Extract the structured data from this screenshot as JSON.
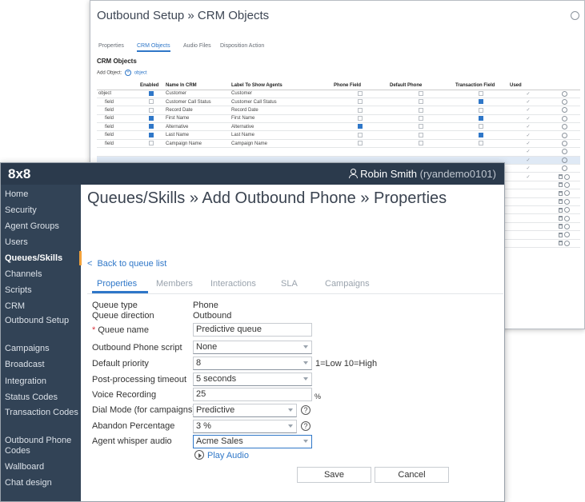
{
  "back_window": {
    "title": "Outbound Setup » CRM Objects",
    "tabs": [
      {
        "label": "Properties",
        "active": false
      },
      {
        "label": "CRM Objects",
        "active": true
      },
      {
        "label": "Audio Files",
        "active": false
      },
      {
        "label": "Disposition Action",
        "active": false
      }
    ],
    "section_title": "CRM Objects",
    "add_object_label": "Add Object:",
    "add_object_link": "object",
    "columns": [
      "",
      "Enabled",
      "Name In CRM",
      "Label To Show Agents",
      "Phone Field",
      "Default Phone",
      "Transaction Field",
      "Used",
      ""
    ],
    "rows": [
      {
        "type": "object",
        "enabled": true,
        "name": "Customer",
        "label": "Customer",
        "phone": false,
        "default_phone": false,
        "transaction": false,
        "used": "✓",
        "actions": "gear"
      },
      {
        "type": "field",
        "enabled": false,
        "name": "Customer Call Status",
        "label": "Customer Call Status",
        "phone": false,
        "default_phone": false,
        "transaction": true,
        "used": "✓",
        "actions": "gear"
      },
      {
        "type": "field",
        "enabled": false,
        "name": "Record Date",
        "label": "Record Date",
        "phone": false,
        "default_phone": false,
        "transaction": false,
        "used": "✓",
        "actions": "gear"
      },
      {
        "type": "field",
        "enabled": true,
        "name": "First Name",
        "label": "First Name",
        "phone": false,
        "default_phone": false,
        "transaction": true,
        "used": "✓",
        "actions": "gear"
      },
      {
        "type": "field",
        "enabled": true,
        "name": "Alternative",
        "label": "Alternative",
        "phone": true,
        "default_phone": false,
        "transaction": false,
        "used": "✓",
        "actions": "gear"
      },
      {
        "type": "field",
        "enabled": true,
        "name": "Last Name",
        "label": "Last Name",
        "phone": false,
        "default_phone": false,
        "transaction": true,
        "used": "✓",
        "actions": "gear"
      },
      {
        "type": "field",
        "enabled": false,
        "name": "Campaign Name",
        "label": "Campaign Name",
        "phone": false,
        "default_phone": false,
        "transaction": false,
        "used": "✓",
        "actions": "gear"
      }
    ]
  },
  "app": {
    "logo": "8x8",
    "user_name": "Robin Smith",
    "user_id": "(ryandemo0101)"
  },
  "sidebar": {
    "items": [
      {
        "label": "Home",
        "active": false
      },
      {
        "label": "Security",
        "active": false
      },
      {
        "label": "Agent Groups",
        "active": false
      },
      {
        "label": "Users",
        "active": false
      },
      {
        "label": "Queues/Skills",
        "active": true
      },
      {
        "label": "Channels",
        "active": false
      },
      {
        "label": "Scripts",
        "active": false
      },
      {
        "label": "CRM",
        "active": false
      },
      {
        "label": "Outbound Setup",
        "active": false
      },
      {
        "label": "Campaigns",
        "active": false
      },
      {
        "label": "Broadcast",
        "active": false
      },
      {
        "label": "Integration",
        "active": false
      },
      {
        "label": "Status Codes",
        "active": false
      },
      {
        "label": "Transaction Codes",
        "active": false
      },
      {
        "label": "Outbound Phone Codes",
        "active": false
      },
      {
        "label": "Wallboard",
        "active": false
      },
      {
        "label": "Chat design",
        "active": false
      }
    ]
  },
  "page": {
    "title": "Queues/Skills » Add Outbound Phone » Properties",
    "back_link": "Back to queue list",
    "tabs": [
      {
        "label": "Properties",
        "active": true
      },
      {
        "label": "Members",
        "active": false
      },
      {
        "label": "Interactions",
        "active": false
      },
      {
        "label": "SLA",
        "active": false
      },
      {
        "label": "Campaigns",
        "active": false
      }
    ]
  },
  "form": {
    "queue_type_label": "Queue type",
    "queue_type_value": "Phone",
    "queue_direction_label": "Queue direction",
    "queue_direction_value": "Outbound",
    "queue_name_label": "Queue name",
    "queue_name_required": "*",
    "queue_name_value": "Predictive queue",
    "script_label": "Outbound Phone script",
    "script_value": "None",
    "priority_label": "Default priority",
    "priority_value": "8",
    "priority_hint": "1=Low 10=High",
    "post_processing_label": "Post-processing timeout",
    "post_processing_value": "5 seconds",
    "voice_recording_label": "Voice Recording",
    "voice_recording_value": "25",
    "voice_recording_unit": "%",
    "dial_mode_label": "Dial Mode (for campaigns)",
    "dial_mode_value": "Predictive",
    "abandon_label": "Abandon Percentage",
    "abandon_value": "3 %",
    "whisper_label": "Agent whisper audio",
    "whisper_value": "Acme Sales",
    "play_audio": "Play Audio",
    "help_glyph": "?"
  },
  "buttons": {
    "save": "Save",
    "cancel": "Cancel"
  },
  "colors": {
    "topbar": "#2b3a4c",
    "sidebar": "#324356",
    "accent": "#2f77c8",
    "active_marker": "#f2a23a"
  }
}
